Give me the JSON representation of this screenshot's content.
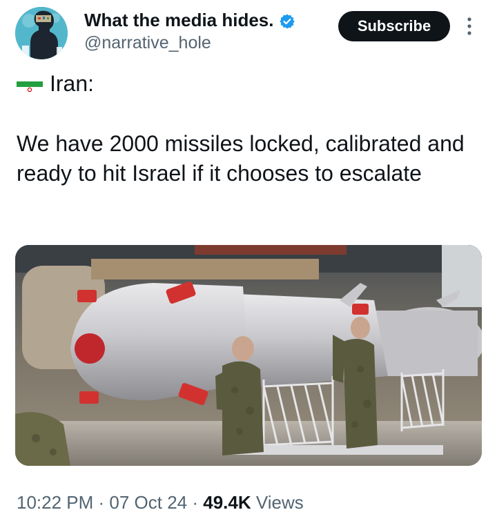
{
  "author": {
    "display_name": "What the media hides.",
    "handle": "@narrative_hole",
    "avatar_icon": "avatar-illustration",
    "verified_icon": "verified-badge-icon",
    "verified_color": "#1d9bf0"
  },
  "actions": {
    "subscribe_label": "Subscribe",
    "more_icon": "more-vertical-icon"
  },
  "tweet": {
    "flag_icon": "iran-flag-icon",
    "line1": "Iran:",
    "body": "We have 2000 missiles locked, calibrated and ready to hit Israel if it chooses to escalate"
  },
  "media": {
    "image_icon": "photo-missiles-on-launchers"
  },
  "meta": {
    "time": "10:22 PM",
    "sep1": " · ",
    "date": "07 Oct 24",
    "sep2": " · ",
    "views_count": "49.4K",
    "views_label": " Views"
  },
  "colors": {
    "text_primary": "#0f1419",
    "text_secondary": "#536471",
    "button_bg": "#0f1419",
    "button_text": "#ffffff"
  }
}
